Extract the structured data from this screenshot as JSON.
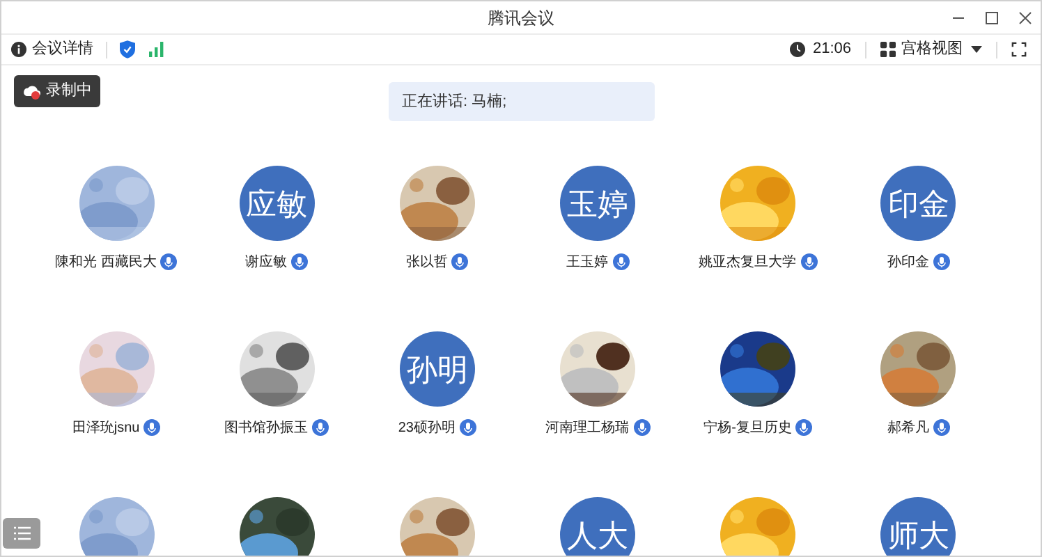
{
  "window": {
    "title": "腾讯会议"
  },
  "toolbar": {
    "details": "会议详情",
    "time": "21:06",
    "view": "宫格视图"
  },
  "recording": {
    "label": "录制中"
  },
  "speaking": {
    "text": "正在讲话: 马楠;"
  },
  "participants": [
    {
      "name": "陳和光 西藏民大",
      "avatar": {
        "kind": "picture"
      }
    },
    {
      "name": "谢应敏",
      "avatar": {
        "kind": "initials",
        "text": "应敏"
      }
    },
    {
      "name": "张以哲",
      "avatar": {
        "kind": "picture"
      }
    },
    {
      "name": "王玉婷",
      "avatar": {
        "kind": "initials",
        "text": "玉婷"
      }
    },
    {
      "name": "姚亚杰复旦大学",
      "avatar": {
        "kind": "picture"
      }
    },
    {
      "name": "孙印金",
      "avatar": {
        "kind": "initials",
        "text": "印金"
      }
    },
    {
      "name": "田泽玧jsnu",
      "avatar": {
        "kind": "picture"
      }
    },
    {
      "name": "图书馆孙振玉",
      "avatar": {
        "kind": "picture"
      }
    },
    {
      "name": "23硕孙明",
      "avatar": {
        "kind": "initials",
        "text": "孙明"
      }
    },
    {
      "name": "河南理工杨瑞",
      "avatar": {
        "kind": "picture"
      }
    },
    {
      "name": "宁杨-复旦历史",
      "avatar": {
        "kind": "picture"
      }
    },
    {
      "name": "郝希凡",
      "avatar": {
        "kind": "picture"
      }
    },
    {
      "avatar": {
        "kind": "picture"
      }
    },
    {
      "avatar": {
        "kind": "picture"
      }
    },
    {
      "avatar": {
        "kind": "picture"
      }
    },
    {
      "avatar": {
        "kind": "initials",
        "text": "人大"
      }
    },
    {
      "avatar": {
        "kind": "picture"
      }
    },
    {
      "avatar": {
        "kind": "initials",
        "text": "师大"
      }
    }
  ]
}
